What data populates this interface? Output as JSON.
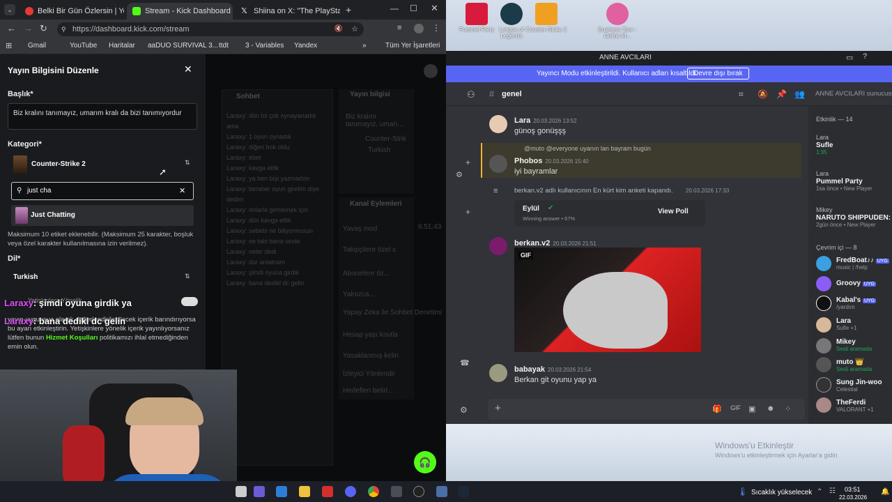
{
  "tabs": [
    {
      "label": "Belki Bir Gün Özlersin | Yo",
      "color": "#e53935"
    },
    {
      "label": "Stream - Kick Dashboard",
      "color": "#53fc18"
    },
    {
      "label": "Shiina on X: \"The PlayStation s",
      "color": "#ffffff"
    }
  ],
  "url": "https://dashboard.kick.com/stream",
  "bookmarks": [
    "Gmail",
    "YouTube",
    "Haritalar",
    "aaDUO SURVIVAL 3...",
    "ttdt",
    "3 - Variables",
    "Yandex",
    "Tüm Yer İşaretleri"
  ],
  "modal": {
    "title": "Yayın Bilgisini Düzenle",
    "title_label": "Başlık*",
    "title_value": "Biz kralını tanımayız, umarım kralı da bizi tanımıyordur",
    "category_label": "Kategori*",
    "category_value": "Counter-Strike 2",
    "search_value": "just cha",
    "search_result": "Just Chatting",
    "tags_hint": "Maksimum 10 etiket eklenebilir. (Maksimum 25 karakter, boşluk veya özel karakter kullanılmasına izin verilmez).",
    "language_label": "Dil*",
    "language_value": "Turkish",
    "adult_label": "Yetişkinlere Yönelik",
    "adult_text_1": "yayın uygunsuz olarak değerlendirilebilecek içerik barındırıyorsa bu ayarı etkinleştirin. Yetişkinlere yönelik içerik yayınlıyorsanız lütfen bunun",
    "adult_link": "Hizmet Koşulları",
    "adult_text_2": "politikamızı ihlal etmediğinden emin olun."
  },
  "overlay_chat": [
    {
      "user": "Laraxy",
      "text": "şimdi oyuna girdik ya"
    },
    {
      "user": "Laraxy",
      "text": "bana dedikl dc gelin"
    }
  ],
  "kick_bg": {
    "chat_title": "Sohbet",
    "stream_info": "Yayın bilgisi",
    "stream_title_preview": "Biz kralını tanımayız, umarı...",
    "stream_game": "Counter-Strik",
    "stream_lang": "Turkish",
    "channel_actions": "Kanal Eylemleri",
    "actions": [
      "Yavaş mod",
      "Takipçilere özel s",
      "Abonelere öz...",
      "Yalnızca...",
      "Yapay Zeka ile Sohbet Denetimi",
      "Hesap yaşı kısıtla",
      "Yasaklanmış kelin",
      "İzleyici Yönlendir",
      "Hedefleri belirl..."
    ],
    "chat_lines": [
      "Laraxy: dün lol çok oynayanadık ama",
      "Laraxy: 1 oyun oynadık",
      "Laraxy: diğeri bok oldu",
      "Laraxy: ebet",
      "Laraxy: kavga ettik",
      "Laraxy: ya ben bişi yazmadım",
      "Laraxy: beraber oyun girelim diye dedim",
      "Laraxy: onlarla girmemek için",
      "Laraxy: dün kavga ettik",
      "Laraxy: sebebi ne biliyormusun",
      "Laraxy: ee tabi bana seste",
      "Laraxy: neler dedi",
      "Laraxy: dur anlatcam",
      "Laraxy: şimdi oyuna girdik",
      "Laraxy: bana dedikl dc gelin"
    ],
    "timer": "6:51:43"
  },
  "discord": {
    "server": "ANNE AVCILARI",
    "banner": "Yayıncı Modu etkinleştirildi. Kullanıcı adları kısaltıldı.",
    "banner_button": "Devre dışı bırak",
    "channel": "genel",
    "search_placeholder": "ANNE AVCILARI sunucusu",
    "messages": [
      {
        "name": "Lara",
        "time": "20.03.2026 13:52",
        "text": "günoş gonüşşş"
      },
      {
        "reply": "@muto @everyone uyanın lan bayram bugün",
        "name": "Phobos",
        "time": "20.03.2026 15:40",
        "text": "iyi bayramlar"
      },
      {
        "system": "berkan.v2 adlı kullanıcının En kürt kim anketi kapandı.",
        "time": "20.03.2026 17:33"
      },
      {
        "name": "berkan.v2",
        "time": "20.03.2026 21:51",
        "text": ""
      },
      {
        "name": "babayak",
        "time": "20.03.2026 21:54",
        "text": "Berkan git oyunu yap ya"
      }
    ],
    "poll": {
      "answer": "Eylül",
      "sub": "Winning answer • 67%",
      "button": "View Poll"
    },
    "gif_label": "GIF",
    "members_activity_header": "Etkinlik — 14",
    "activity": [
      {
        "name": "Lara",
        "status": "Sufle",
        "sub": "1:35"
      },
      {
        "name": "Lara",
        "status": "Pummel Party",
        "sub": "1sa önce • New Player"
      },
      {
        "name": "Mikey",
        "status": "NARUTO SHIPPUDEN: Ulti",
        "sub": "2gün önce • New Player"
      }
    ],
    "online_header": "Çevrim içi — 8",
    "online": [
      {
        "name": "FredBoat♪♪",
        "sub": "music | /help",
        "color": "#3aa0e0",
        "bot": "UYG"
      },
      {
        "name": "Groovy",
        "sub": "",
        "color": "#8b5cf6",
        "bot": "UYG"
      },
      {
        "name": "Kabal's",
        "sub": "/yardım",
        "color": "#111",
        "bot": "UYG"
      },
      {
        "name": "Lara",
        "sub": "Sufle +1",
        "color": "#d8b89a",
        "bot": ""
      },
      {
        "name": "Mikey",
        "sub": "Sesli aramada",
        "color": "#777",
        "bot": ""
      },
      {
        "name": "muto 👑",
        "sub": "Sesli aramada",
        "color": "#555",
        "bot": ""
      },
      {
        "name": "Sung Jin-woo",
        "sub": "Celestial",
        "color": "#333",
        "bot": ""
      },
      {
        "name": "TheFerdi",
        "sub": "VALORANT +1",
        "color": "#a88",
        "bot": ""
      }
    ]
  },
  "desktop": {
    "icons": [
      "Pummel Party",
      "League of Legends",
      "Counter-Strike 2",
      "Business Tour - Online M..."
    ],
    "watermark_1": "Windows'u Etkinleştir",
    "watermark_2": "Windows'u etkinleştirmek için Ayarlar'a gidin"
  },
  "taskbar": {
    "weather": "Sıcaklık yükselecek",
    "time": "03:51",
    "date": "22.03.2026"
  }
}
